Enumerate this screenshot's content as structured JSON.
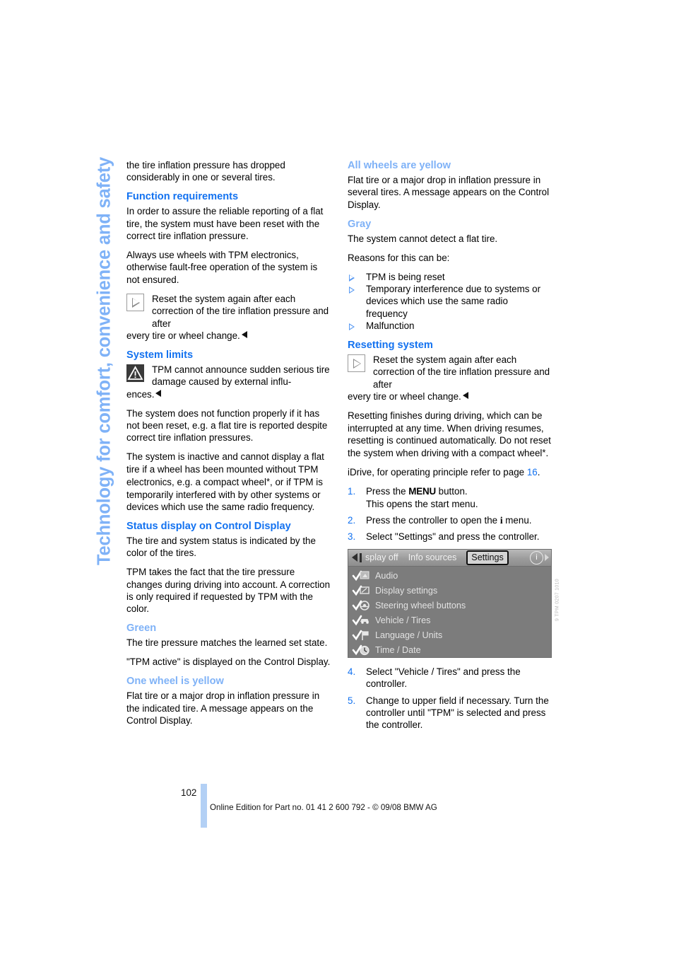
{
  "running_head": "Technology for comfort, convenience and safety",
  "left_column": {
    "intro": "the tire inflation pressure has dropped considerably in one or several tires.",
    "function_requirements": {
      "heading": "Function requirements",
      "p1": "In order to assure the reliable reporting of a flat tire, the system must have been reset with the correct tire inflation pressure.",
      "p2": "Always use wheels with TPM electronics, otherwise fault-free operation of the system is not ensured.",
      "note_indented": "Reset the system again after each correction of the tire inflation pressure and after",
      "note_run": "every tire or wheel change."
    },
    "system_limits": {
      "heading": "System limits",
      "warn_indented": "TPM cannot announce sudden serious tire damage caused by external influ-",
      "warn_run": "ences.",
      "p1": "The system does not function properly if it has not been reset, e.g. a flat tire is reported despite correct tire inflation pressures.",
      "p2_part1": "The system is inactive and cannot display a flat tire if a wheel has been mounted without TPM electronics, e.g. a compact wheel",
      "p2_star": "*",
      "p2_part2": ", or if TPM is temporarily interfered with by other systems or devices which use the same radio frequency."
    },
    "status_display": {
      "heading": "Status display on Control Display",
      "p1": "The tire and system status is indicated by the color of the tires.",
      "p2": "TPM takes the fact that the tire pressure changes during driving into account. A correction is only required if requested by TPM with the color."
    },
    "green": {
      "heading": "Green",
      "p1": "The tire pressure matches the learned set state.",
      "p2": "\"TPM active\" is displayed on the Control Display."
    },
    "one_wheel_yellow": {
      "heading": "One wheel is yellow",
      "p1": "Flat tire or a major drop in inflation pressure in the indicated tire. A message appears on the Control Display."
    }
  },
  "right_column": {
    "all_wheels_yellow": {
      "heading": "All wheels are yellow",
      "p1": "Flat tire or a major drop in inflation pressure in several tires. A message appears on the Control Display."
    },
    "gray": {
      "heading": "Gray",
      "p1": "The system cannot detect a flat tire.",
      "p2": "Reasons for this can be:",
      "bullets": [
        "TPM is being reset",
        "Temporary interference due to systems or devices which use the same radio frequency",
        "Malfunction"
      ]
    },
    "resetting_system": {
      "heading": "Resetting system",
      "note_indented": "Reset the system again after each correction of the tire inflation pressure and after",
      "note_run": "every tire or wheel change.",
      "p1_part1": "Resetting finishes during driving, which can be interrupted at any time. When driving resumes, resetting is continued automatically. Do not reset the system when driving with a compact wheel",
      "p1_star": "*",
      "p1_part2": ".",
      "idrive_ref_part1": "iDrive, for operating principle refer to page ",
      "idrive_ref_page": "16",
      "idrive_ref_part2": ".",
      "steps": [
        {
          "num": "1.",
          "text_part1": "Press the ",
          "kbd": "MENU",
          "text_part2": " button.",
          "text_line2": "This opens the start menu."
        },
        {
          "num": "2.",
          "text_part1": "Press the controller to open the ",
          "kbd": "i",
          "text_part2": " menu."
        },
        {
          "num": "3.",
          "text_part1": "Select \"Settings\" and press the controller."
        },
        {
          "num": "4.",
          "text_part1": "Select \"Vehicle / Tires\" and press the controller."
        },
        {
          "num": "5.",
          "text_part1": "Change to upper field if necessary. Turn the controller until \"TPM\" is selected and press the controller."
        }
      ]
    }
  },
  "idrive_screen": {
    "tabs": [
      {
        "label": "splay off",
        "selected": false
      },
      {
        "label": "Info sources",
        "selected": false
      },
      {
        "label": "Settings",
        "selected": true
      }
    ],
    "info_icon": "i",
    "menu_items": [
      {
        "label": "Audio",
        "icon": "audio-icon"
      },
      {
        "label": "Display settings",
        "icon": "display-icon"
      },
      {
        "label": "Steering wheel buttons",
        "icon": "steering-wheel-icon"
      },
      {
        "label": "Vehicle / Tires",
        "icon": "vehicle-icon"
      },
      {
        "label": "Language / Units",
        "icon": "flag-icon"
      },
      {
        "label": "Time / Date",
        "icon": "clock-icon"
      }
    ],
    "side_code": "9 TPM 0207 1010"
  },
  "footer": {
    "page_number": "102",
    "credit": "Online Edition for Part no. 01 41 2 600 792 - © 09/08 BMW AG"
  },
  "colors": {
    "heading_blue": "#1372f0",
    "subheading_blue": "#7fb2f7",
    "bar_blue": "#b3d0f5"
  }
}
